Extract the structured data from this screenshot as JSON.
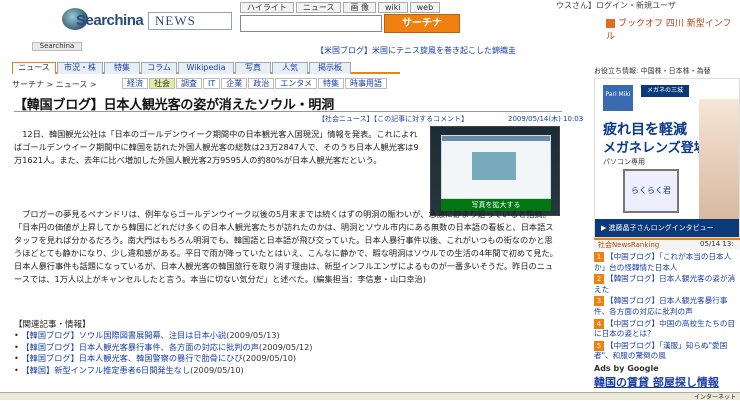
{
  "header": {
    "logo": "Searchina",
    "news_label": "NEWS",
    "search_tabs": [
      "ハイライト",
      "ニュース",
      "画 像",
      "wiki",
      "web"
    ],
    "search_button": "サーチナ",
    "search_radio": "",
    "top_right": "ウスさん】ログイン・新規ユーザ",
    "top_right_link": "ブックオフ 四川 新型インフル"
  },
  "subheader": {
    "tag": "Searchina",
    "ticker": "【米国ブログ】米国にテニス旋風を巻き起こした錦織圭"
  },
  "nav": {
    "tabs": [
      "ニュース",
      "市況・株",
      "特集",
      "コラム",
      "Wikipedia",
      "写真",
      "人気",
      "掲示板"
    ]
  },
  "subnav": {
    "crumb": "サーチナ > ニュース >",
    "tabs": [
      "経済",
      "社会",
      "調査",
      "IT",
      "企業",
      "政治",
      "エンタメ",
      "特集",
      "時事用語"
    ],
    "active_tab": "社会"
  },
  "article": {
    "title": "【韓国ブログ】日本人観光客の姿が消えたソウル・明洞",
    "meta": "【社会ニュース】【この記事に対するコメント】",
    "date": "2009/05/14(木) 10:03",
    "photo_caption": "写真を拡大する",
    "para1": "　12日、韓国観光公社は「日本のゴールデンウイーク期間中の日本観光客入国現況」情報を発表。これによればゴールデンウイーク期間中に韓国を訪れた外国人観光客の総数は23万2847人で、そのうち日本人観光客は9万1621人。また、去年に比べ増加した外国人観光客2万9595人の約80%が日本人観光客だという。",
    "para2": "　ブロガーの夢見るペナンドリは、例年ならゴールデンウイーク以後の5月末までは続くはずの明洞の賑わいが、急激に静まり返っていると指摘。「日本円の価値が上昇してから韓国にどれだけ多くの日本人観光客たちが訪れたのかは、明洞とソウル市内にある無数の日本語の看板と、日本語スタッフを見れば分かるだろう。南大門はもちろん明洞でも、韓国語と日本語が飛び交っていた。日本人暴行事件以後、これがいつもの街なのかと思うほどとても静かになり、少し違和感がある。平日で雨が降っていたとはいえ、こんなに静かで、暇な明洞はソウルでの生活の4年間で初めて見た。日本人暴行事件も話題になっているが、日本人観光客の韓国旅行を取り消す理由は、新型インフルエンザによるものが一番多いそうだ。昨日のニュースでは、1万人以上がキャンセルしたと言う。本当に切ない気分だ」と述べた。(編集担当：李信恵・山口幸治)"
  },
  "related": {
    "title": "【関連記事・情報】",
    "items": [
      {
        "text": "【韓国ブログ】ソウル国際図書展開幕、注目は日本小説",
        "date": "(2009/05/13)"
      },
      {
        "text": "【韓国ブログ】日本人観光客暴行事件、各方面の対応に批判の声",
        "date": "(2009/05/12)"
      },
      {
        "text": "【韓国ブログ】日本人観光客、韓国警察の暴行で肋骨にひび",
        "date": "(2009/05/10)"
      },
      {
        "text": "【韓国】新型インフル推定患者6日間発生なし",
        "date": "(2009/05/10)"
      }
    ]
  },
  "sidebar": {
    "head": "お役立ち情報: 中国株・日本株・為替",
    "ad": {
      "logo1": "Pari Miki",
      "logo2": "メガネの三城",
      "line1": "疲れ目を軽減",
      "line2": "メガネレンズ登場",
      "line3": "パソコン専用",
      "pc_label": "らくらく君",
      "footer": "▶ 進藤晶子さんロングインタビュー"
    },
    "ranking": {
      "head": "社会NewsRanking",
      "date": "05/14 13:",
      "items": [
        {
          "num": "1",
          "text": "【中国ブログ】「これが本当の日本人か」台の怪韓情た日本人"
        },
        {
          "num": "2",
          "text": "【韓国ブログ】日本人観光客の姿が消えた"
        },
        {
          "num": "3",
          "text": "【韓国ブログ】日本人観光客暴行事件、各方面の対応に批判の声"
        },
        {
          "num": "4",
          "text": "【中国ブログ】中国の高校生たちの目に日本の姿とは？"
        },
        {
          "num": "5",
          "text": "【中国ブログ】「漢服」知らぬ\"愛国者\"、和服の驚倒の風"
        }
      ]
    },
    "ads_by": "Ads by Google",
    "ads_link": "韓国の賃貸 部屋探し情報"
  },
  "status": {
    "net": "インターネット"
  }
}
